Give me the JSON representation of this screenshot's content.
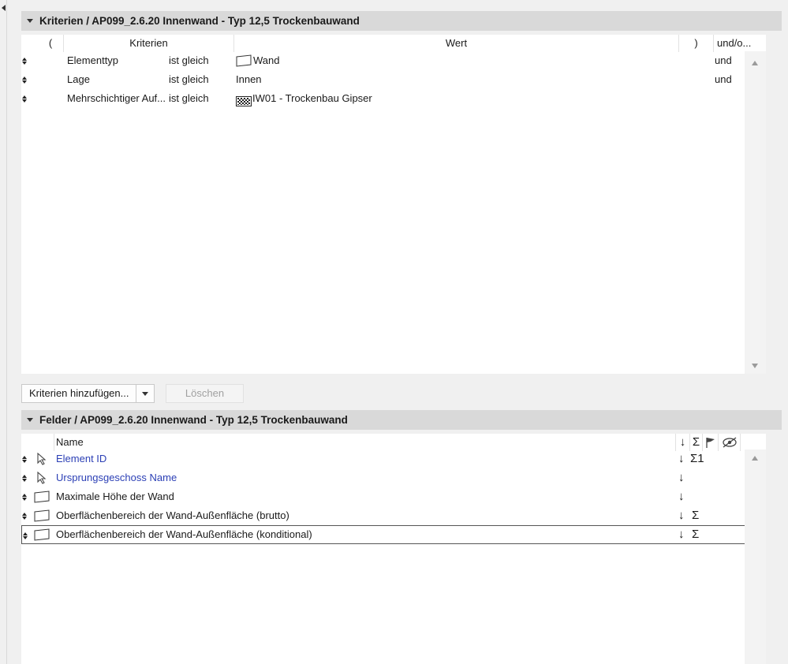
{
  "criteria_section": {
    "title": "Kriterien / AP099_2.6.20 Innenwand - Typ 12,5 Trockenbauwand",
    "columns": {
      "open_paren": "(",
      "criteria": "Kriterien",
      "value": "Wert",
      "close_paren": ")",
      "andor": "und/o..."
    },
    "rows": [
      {
        "criterion": "Elementtyp",
        "operator": "ist gleich",
        "value": "Wand",
        "value_icon": "wall-outline-icon",
        "andor": "und"
      },
      {
        "criterion": "Lage",
        "operator": "ist gleich",
        "value": "Innen",
        "value_icon": "",
        "andor": "und"
      },
      {
        "criterion": "Mehrschichtiger Auf...",
        "operator": "ist gleich",
        "value": "IW01 - Trockenbau Gipser",
        "value_icon": "hatch-pattern-icon",
        "andor": ""
      }
    ],
    "add_button": "Kriterien hinzufügen...",
    "delete_button": "Löschen"
  },
  "fields_section": {
    "title": "Felder / AP099_2.6.20 Innenwand - Typ 12,5 Trockenbauwand",
    "columns": {
      "name": "Name",
      "sort": "↓",
      "sum": "Σ",
      "flag": "flag-icon",
      "hide": "eye-hidden-icon"
    },
    "rows": [
      {
        "name": "Element ID",
        "icon": "cursor-arrow-icon",
        "is_link": true,
        "sort": "↓",
        "sum": "Σ1",
        "selected": false
      },
      {
        "name": "Ursprungsgeschoss Name",
        "icon": "cursor-arrow-icon",
        "is_link": true,
        "sort": "↓",
        "sum": "",
        "selected": false
      },
      {
        "name": "Maximale Höhe der Wand",
        "icon": "wall-outline-icon",
        "is_link": false,
        "sort": "↓",
        "sum": "",
        "selected": false
      },
      {
        "name": "Oberflächenbereich der Wand-Außenfläche (brutto)",
        "icon": "wall-outline-icon",
        "is_link": false,
        "sort": "↓",
        "sum": "Σ",
        "selected": false
      },
      {
        "name": "Oberflächenbereich der Wand-Außenfläche (konditional)",
        "icon": "wall-outline-icon",
        "is_link": false,
        "sort": "↓",
        "sum": "Σ",
        "selected": true
      }
    ]
  },
  "colors": {
    "link": "#2b3fb5",
    "header_bg": "#d9d9d9",
    "panel_bg": "#ffffff",
    "window_bg": "#f0f0f0"
  }
}
